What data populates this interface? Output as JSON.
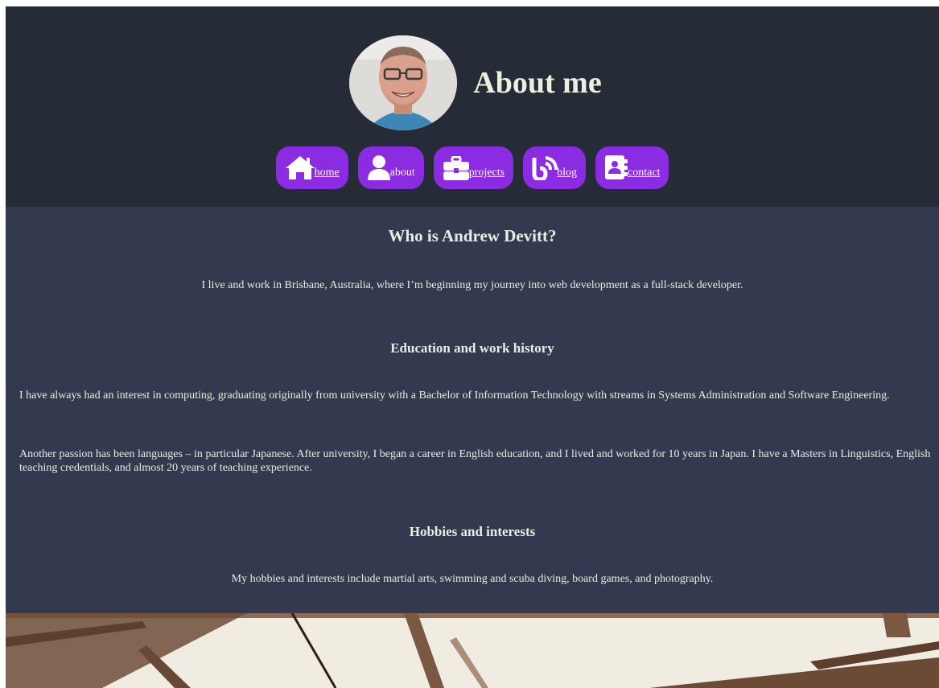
{
  "header": {
    "title": "About me",
    "avatar_alt": "Andrew Devitt portrait"
  },
  "nav": [
    {
      "label": "home",
      "icon": "home-icon",
      "underlined": true
    },
    {
      "label": "about",
      "icon": "user-icon",
      "underlined": false
    },
    {
      "label": "projects",
      "icon": "briefcase-icon",
      "underlined": true
    },
    {
      "label": "blog",
      "icon": "rss-icon",
      "underlined": true
    },
    {
      "label": "contact",
      "icon": "address-book-icon",
      "underlined": true
    }
  ],
  "main": {
    "heading": "Who is Andrew Devitt?",
    "intro": "I live and work in Brisbane, Australia, where I’m beginning my journey into web development as a full-stack developer.",
    "education": {
      "heading": "Education and work history",
      "paragraphs": [
        "I have always had an interest in computing, graduating originally from university with a Bachelor of Information Technology with streams in Systems Administration and Software Engineering.",
        "Another passion has been languages – in particular Japanese. After university, I began a career in English education, and I lived and worked for 10 years in Japan. I have a Masters in Linguistics, English teaching credentials, and almost 20 years of teaching experience."
      ]
    },
    "hobbies": {
      "heading": "Hobbies and interests",
      "text": "My hobbies and interests include martial arts, swimming and scuba diving, board games, and photography."
    }
  },
  "colors": {
    "header_bg": "#262b38",
    "main_bg": "#333a4f",
    "accent": "#8b2be2",
    "text": "#e7eedf"
  }
}
